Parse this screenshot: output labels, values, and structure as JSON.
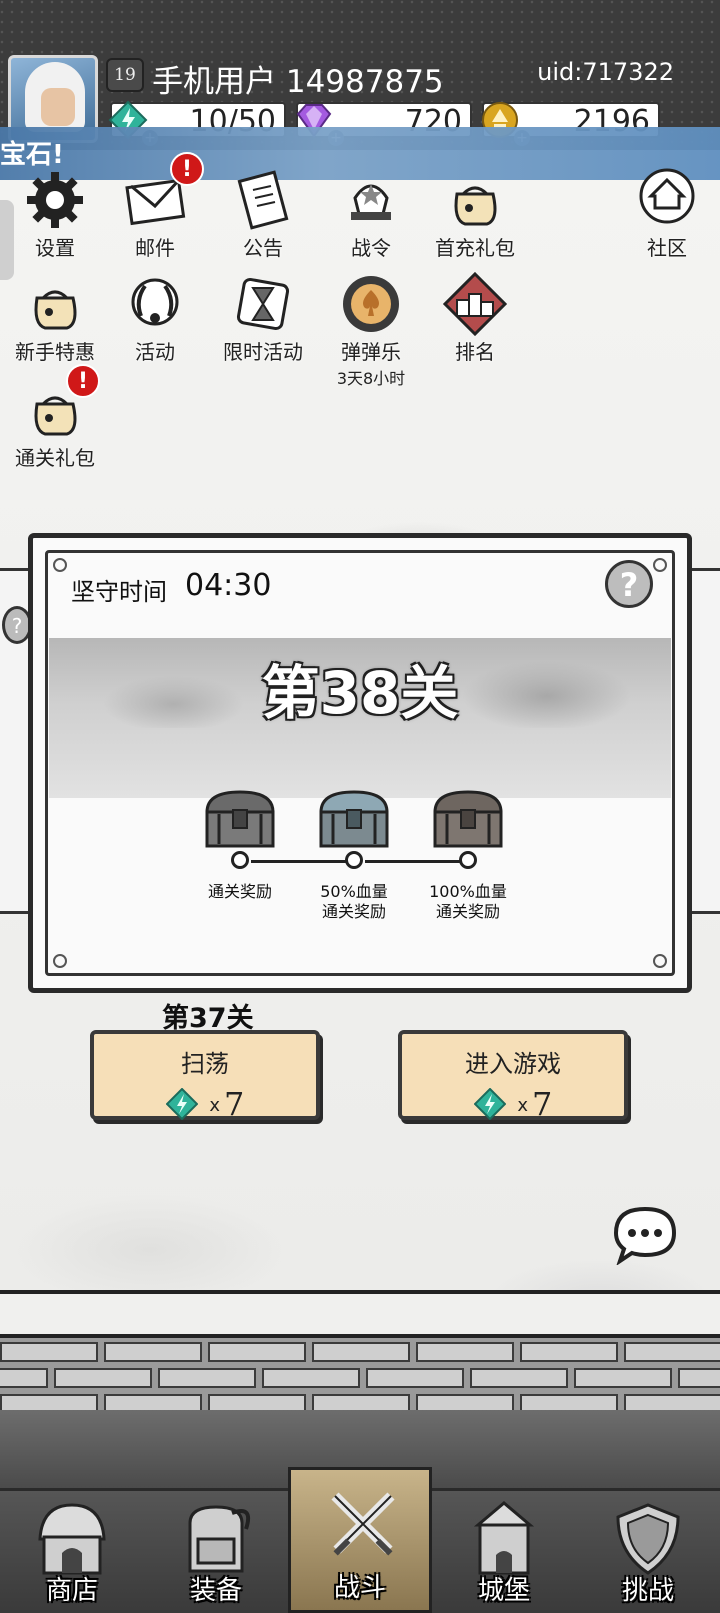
{
  "player": {
    "level": "19",
    "name": "手机用户 14987875",
    "uid": "uid:717322"
  },
  "resources": [
    {
      "name": "energy",
      "icon": "energy-gem-icon",
      "value": "10/50"
    },
    {
      "name": "diamond",
      "icon": "purple-diamond-icon",
      "value": "720"
    },
    {
      "name": "gold",
      "icon": "gold-coin-icon",
      "value": "2196"
    }
  ],
  "banner": {
    "text": "宝石!"
  },
  "menu": {
    "settings": "设置",
    "mail": "邮件",
    "notice": "公告",
    "battle_pass": "战令",
    "first_recharge": "首充礼包",
    "community": "社区",
    "newbie_offer": "新手特惠",
    "events": "活动",
    "limited_events": "限时活动",
    "pinball": "弹弹乐",
    "pinball_timer": "3天8小时",
    "ranking": "排名",
    "clear_gift": "通关礼包"
  },
  "badges": {
    "mail": "!",
    "clear_gift": "!"
  },
  "stage": {
    "time_label": "坚守时间",
    "time_value": "04:30",
    "help": "?",
    "title": "第38关",
    "rewards": [
      {
        "line1": "通关奖励",
        "line2": ""
      },
      {
        "line1": "50%血量",
        "line2": "通关奖励"
      },
      {
        "line1": "100%血量",
        "line2": "通关奖励"
      }
    ],
    "previous_stage": "第37关"
  },
  "actions": {
    "sweep": {
      "label": "扫荡",
      "cost_x": "x",
      "cost": "7"
    },
    "enter": {
      "label": "进入游戏",
      "cost_x": "x",
      "cost": "7"
    }
  },
  "nav": {
    "shop": "商店",
    "equipment": "装备",
    "battle": "战斗",
    "castle": "城堡",
    "challenge": "挑战"
  },
  "colors": {
    "button_fill": "#f6dfb8",
    "banner_blue": "#5f8fbf",
    "badge_red": "#d01818",
    "nav_active": "#c8b48a"
  }
}
